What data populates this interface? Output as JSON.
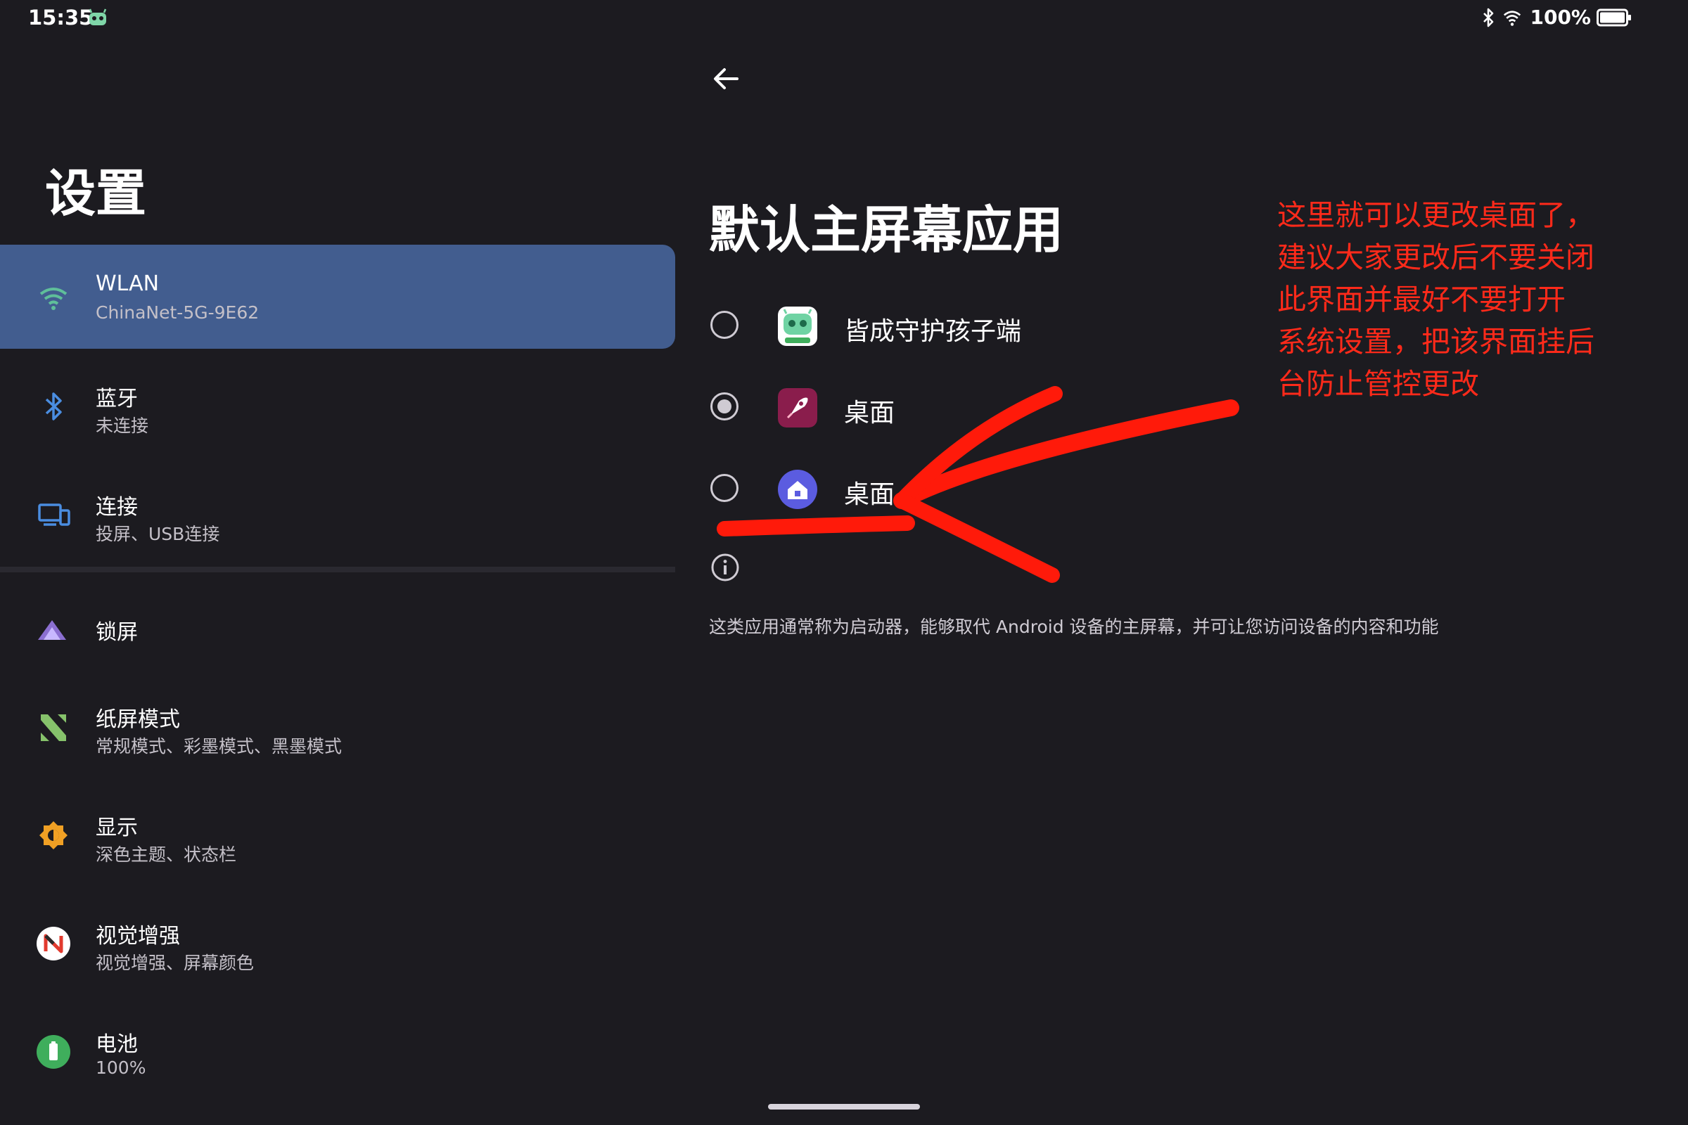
{
  "status_bar": {
    "time": "15:35",
    "app_icon": "kid-guard-robot-icon",
    "bluetooth_icon": "bluetooth-icon",
    "wifi_icon": "wifi-icon",
    "battery_percent": "100%",
    "battery_level": 1.0
  },
  "settings": {
    "title": "设置",
    "items": [
      {
        "icon": "wifi-icon",
        "title": "WLAN",
        "subtitle": "ChinaNet-5G-9E62",
        "selected": true
      },
      {
        "icon": "bluetooth-icon",
        "title": "蓝牙",
        "subtitle": "未连接"
      },
      {
        "icon": "devices-icon",
        "title": "连接",
        "subtitle": "投屏、USB连接"
      },
      {
        "icon": "lockscreen-icon",
        "title": "锁屏"
      },
      {
        "icon": "paper-mode-icon",
        "title": "纸屏模式",
        "subtitle": "常规模式、彩墨模式、黑墨模式"
      },
      {
        "icon": "display-icon",
        "title": "显示",
        "subtitle": "深色主题、状态栏"
      },
      {
        "icon": "vision-enhance-icon",
        "title": "视觉增强",
        "subtitle": "视觉增强、屏幕颜色"
      },
      {
        "icon": "battery-icon",
        "title": "电池",
        "subtitle": "100%"
      }
    ]
  },
  "detail": {
    "back_icon": "back-arrow-icon",
    "title": "默认主屏幕应用",
    "options": [
      {
        "label": "皆成守护孩子端",
        "icon": "kid-guard-app-icon",
        "checked": false
      },
      {
        "label": "桌面",
        "icon": "rocket-launcher-icon",
        "checked": true
      },
      {
        "label": "桌面",
        "icon": "home-launcher-icon",
        "checked": false
      }
    ],
    "info_icon": "info-icon",
    "description": "这类应用通常称为启动器，能够取代 Android 设备的主屏幕，并可让您访问设备的内容和功能"
  },
  "annotation": {
    "lines": [
      "这里就可以更改桌面了，",
      "建议大家更改后不要关闭",
      "此界面并最好不要打开",
      "系统设置，把该界面挂后",
      "台防止管控更改"
    ],
    "color": "#ff2a1a"
  },
  "colors": {
    "background": "#1c1b20",
    "selected_item": "#425d8f",
    "annotation": "#ff2a1a"
  }
}
